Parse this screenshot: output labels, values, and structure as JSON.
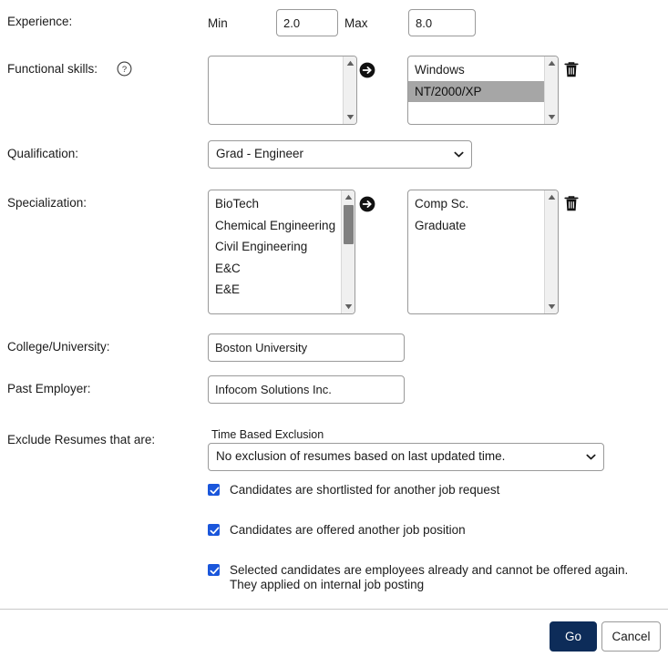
{
  "form": {
    "experience": {
      "label": "Experience:",
      "min_label": "Min",
      "min_value": "2.0",
      "max_label": "Max",
      "max_value": "8.0"
    },
    "functional_skills": {
      "label": "Functional skills:",
      "help_icon": "help-circle-icon",
      "add_icon": "arrow-right-circle-icon",
      "remove_icon": "trash-icon",
      "available": [],
      "selected": [
        "Windows",
        "NT/2000/XP"
      ],
      "selected_highlight": "NT/2000/XP"
    },
    "qualification": {
      "label": "Qualification:",
      "value": "Grad - Engineer",
      "caret_icon": "chevron-down-icon"
    },
    "specialization": {
      "label": "Specialization:",
      "add_icon": "arrow-right-circle-icon",
      "remove_icon": "trash-icon",
      "available": [
        "BioTech",
        "Chemical Engineering",
        "Civil Engineering",
        "E&C",
        "E&E"
      ],
      "selected": [
        "Comp Sc.",
        "Graduate"
      ]
    },
    "college": {
      "label": "College/University:",
      "value": "Boston University"
    },
    "past_employer": {
      "label": "Past Employer:",
      "value": "Infocom Solutions Inc."
    },
    "exclude": {
      "label": "Exclude Resumes that are:",
      "time_caption": "Time Based Exclusion",
      "time_value": "No exclusion of resumes based on last updated time.",
      "caret_icon": "chevron-down-icon",
      "checkboxes": [
        {
          "label": "Candidates are shortlisted for another job request",
          "checked": true
        },
        {
          "label": "Candidates are offered another job position",
          "checked": true
        },
        {
          "label": "Selected candidates are employees already and cannot be offered again.\nThey applied on internal  job posting",
          "checked": true
        }
      ]
    }
  },
  "footer": {
    "go_label": "Go",
    "cancel_label": "Cancel"
  },
  "colors": {
    "primary": "#0d2c59",
    "checkbox": "#1a56db",
    "listbox_highlight": "#a6a6a6",
    "border": "#9a9a9a"
  }
}
